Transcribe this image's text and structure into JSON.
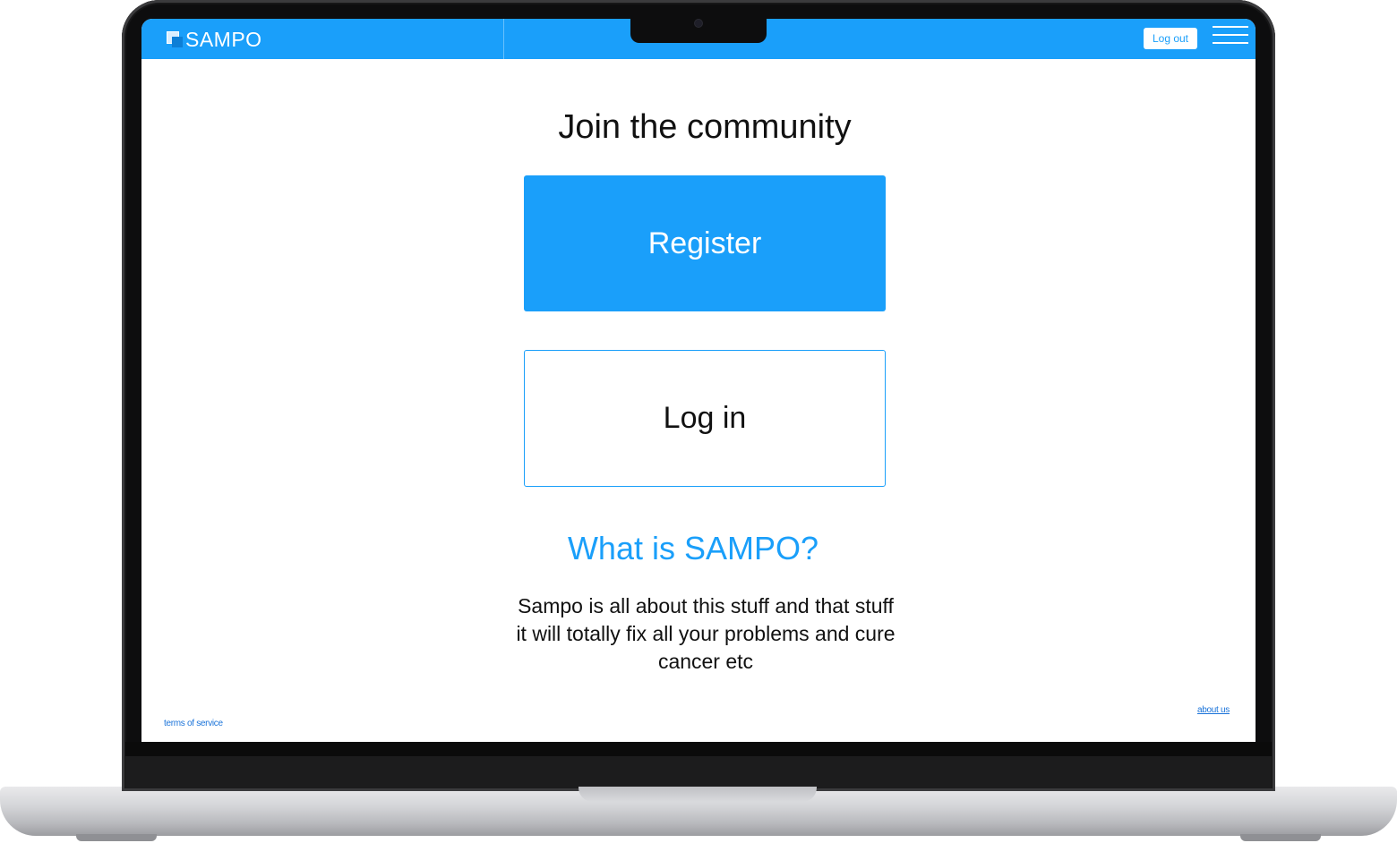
{
  "header": {
    "logo_text": "SAMPO",
    "logout_label": "Log out",
    "brand_color": "#1a9ffa"
  },
  "main": {
    "title": "Join the community",
    "register_label": "Register",
    "login_label": "Log in",
    "about_heading": "What is SAMPO?",
    "description_lines": [
      "Sampo is all about this stuff and that stuff",
      "it will totally fix all your problems and cure",
      "cancer etc"
    ]
  },
  "footer": {
    "terms_label": "terms of service",
    "about_label": "about us"
  },
  "icons": {
    "menu": "hamburger-menu-icon",
    "logo": "sampo-logo-icon",
    "camera": "camera-icon"
  }
}
